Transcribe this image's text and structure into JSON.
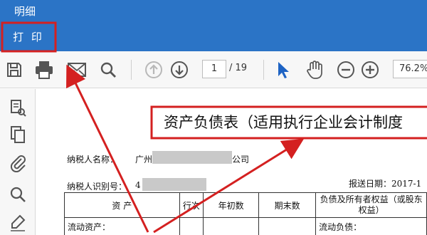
{
  "window": {
    "title": "明细"
  },
  "menu": {
    "print_label": "打 印"
  },
  "toolbar": {
    "page_current": "1",
    "page_total": "/ 19",
    "zoom": "76.2%"
  },
  "document": {
    "title": "资产负债表（适用执行企业会计制度",
    "taxpayer_name_label": "纳税人名称：",
    "taxpayer_name_prefix": "广州",
    "taxpayer_name_suffix": "公司",
    "taxpayer_id_label": "纳税人识别号：",
    "taxpayer_id_prefix": "4",
    "report_date_label": "报送日期：2017-1",
    "table": {
      "headers": [
        "资        产",
        "行次",
        "年初数",
        "期末数",
        "负债及所有者权益（或股东权益）"
      ],
      "row1": [
        "流动资产：",
        "",
        "",
        "",
        "流动负债："
      ]
    }
  },
  "annotation_color": "#d42020"
}
